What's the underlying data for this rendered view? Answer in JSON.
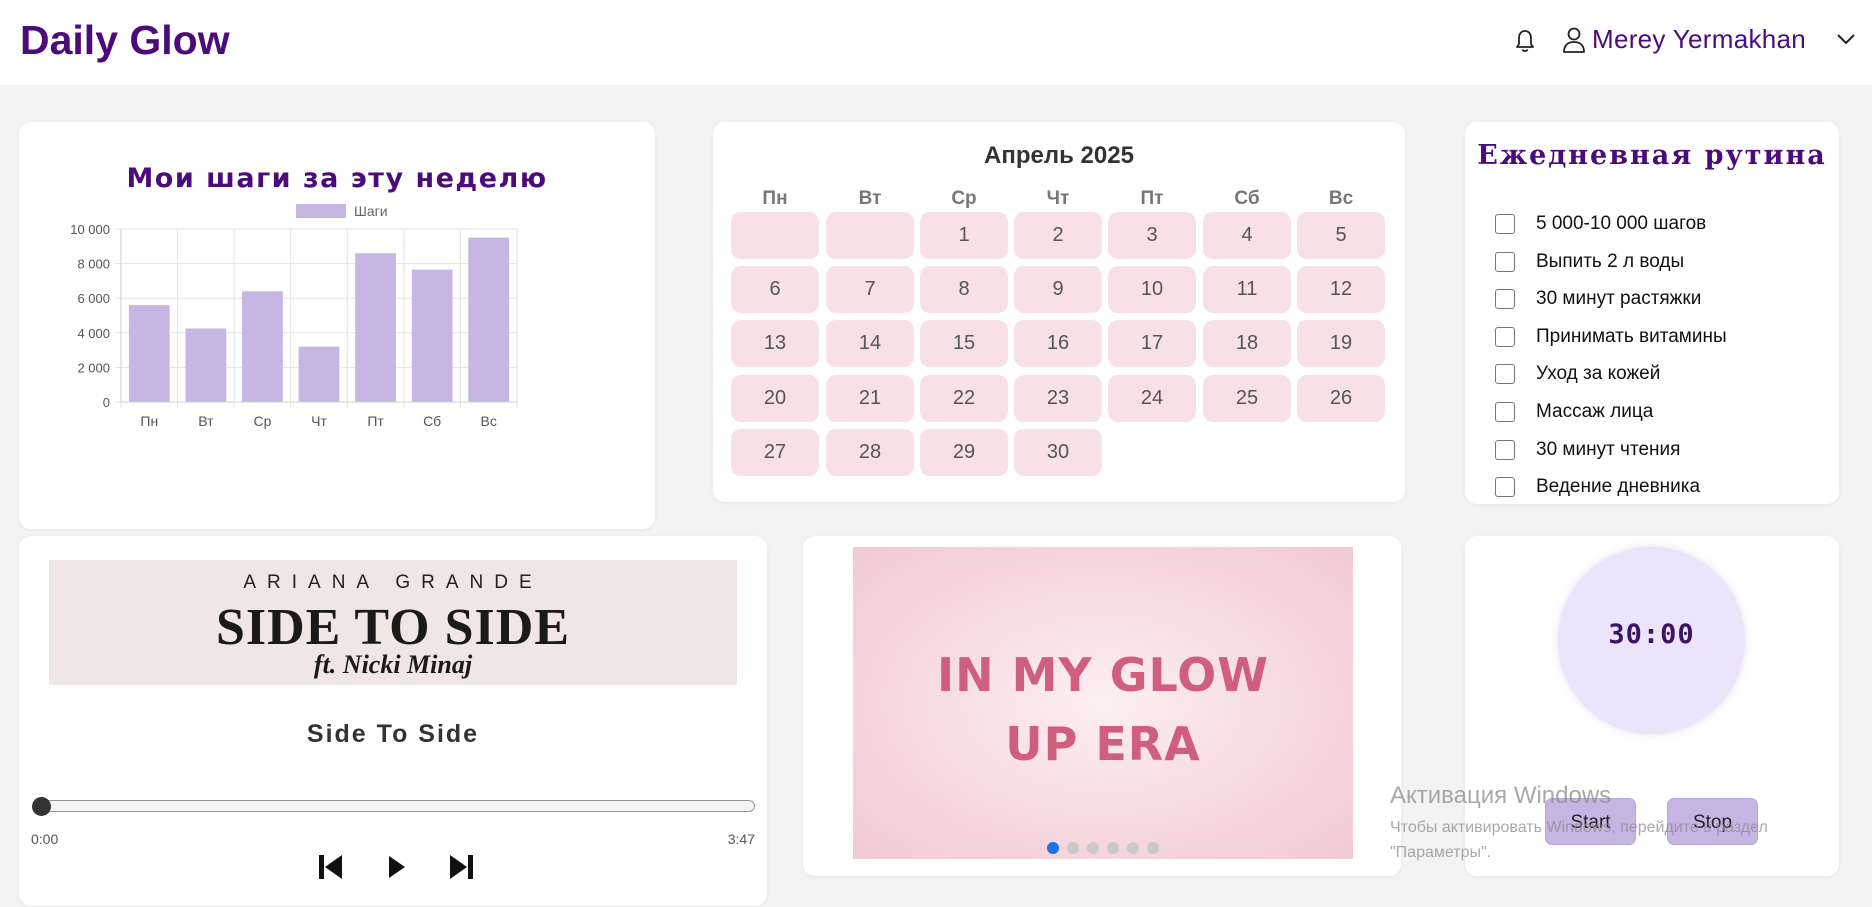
{
  "app": {
    "brand": "Daily Glow"
  },
  "header": {
    "user_name": "Merey Yermakhan",
    "icons": [
      "bell-icon",
      "user-icon",
      "chevron-down-icon"
    ]
  },
  "steps_card": {
    "title": "Мои шаги за эту неделю",
    "chart_data": {
      "type": "bar",
      "categories": [
        "Пн",
        "Вт",
        "Ср",
        "Чт",
        "Пт",
        "Сб",
        "Вс"
      ],
      "series": [
        {
          "name": "Шаги",
          "values": [
            5600,
            4250,
            6400,
            3200,
            8600,
            7650,
            9500
          ]
        }
      ],
      "ylim": [
        0,
        10000
      ],
      "yticks": [
        0,
        2000,
        4000,
        6000,
        8000,
        10000
      ],
      "ytick_labels": [
        "0",
        "2 000",
        "4 000",
        "6 000",
        "8 000",
        "10 000"
      ],
      "grid": true,
      "legend": "top-center",
      "bar_color": "#c7b5e3"
    }
  },
  "calendar": {
    "month_label": "Апрель 2025",
    "weekdays": [
      "Пн",
      "Вт",
      "Ср",
      "Чт",
      "Пт",
      "Сб",
      "Вс"
    ],
    "days": [
      "",
      "",
      "1",
      "2",
      "3",
      "4",
      "5",
      "6",
      "7",
      "8",
      "9",
      "10",
      "11",
      "12",
      "13",
      "14",
      "15",
      "16",
      "17",
      "18",
      "19",
      "20",
      "21",
      "22",
      "23",
      "24",
      "25",
      "26",
      "27",
      "28",
      "29",
      "30"
    ]
  },
  "routine": {
    "title": "Ежедневная рутина",
    "tasks": [
      {
        "label": "5 000-10 000 шагов",
        "checked": false
      },
      {
        "label": "Выпить 2 л воды",
        "checked": false
      },
      {
        "label": "30 минут растяжки",
        "checked": false
      },
      {
        "label": "Принимать витамины",
        "checked": false
      },
      {
        "label": "Уход за кожей",
        "checked": false
      },
      {
        "label": "Массаж лица",
        "checked": false
      },
      {
        "label": "30 минут чтения",
        "checked": false
      },
      {
        "label": "Ведение дневника",
        "checked": false
      }
    ]
  },
  "player": {
    "cover": {
      "artist": "ARIANA GRANDE",
      "title": "SIDE TO SIDE",
      "feat": "ft. Nicki Minaj"
    },
    "song_title": "Side To Side",
    "current_time": "0:00",
    "duration": "3:47",
    "progress": 0,
    "controls": [
      "skip-previous-icon",
      "play-icon",
      "skip-next-icon"
    ]
  },
  "slider": {
    "slide_text_line1": "IN MY GLOW",
    "slide_text_line2": "UP ERA",
    "slide_count": 6,
    "active_slide": 0
  },
  "timer": {
    "display": "30:00",
    "start_label": "Start",
    "stop_label": "Stop"
  },
  "watermark": {
    "title": "Активация Windows",
    "line1": "Чтобы активировать Windows, перейдите в раздел",
    "line2": "\"Параметры\"."
  },
  "colors": {
    "brand": "#4b0b7a",
    "pink_tile": "#f7e1e7",
    "lavender": "#c7b5e3",
    "dot_active": "#1a73e8"
  }
}
